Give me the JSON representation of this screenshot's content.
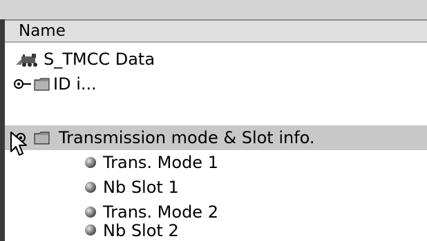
{
  "header": {
    "name_label": "Name"
  },
  "tree": {
    "root_label": "S_TMCC Data",
    "nodes": [
      {
        "label": "ID i..."
      },
      {
        "label": "Transmission mode & Slot info."
      }
    ],
    "children": [
      {
        "label": "Trans. Mode 1"
      },
      {
        "label": "Nb Slot 1"
      },
      {
        "label": "Trans. Mode 2"
      },
      {
        "label": "Nb Slot 2"
      }
    ]
  },
  "icons": {
    "root": "locomotive-icon",
    "expand": "key-toggle-icon",
    "folder": "folder-icon",
    "leaf": "sphere-icon",
    "cursor": "arrow-cursor-icon"
  },
  "colors": {
    "selection": "#c8c8c8",
    "header_bg": "#e0e0e0",
    "panel_border": "#3a3a3a"
  }
}
